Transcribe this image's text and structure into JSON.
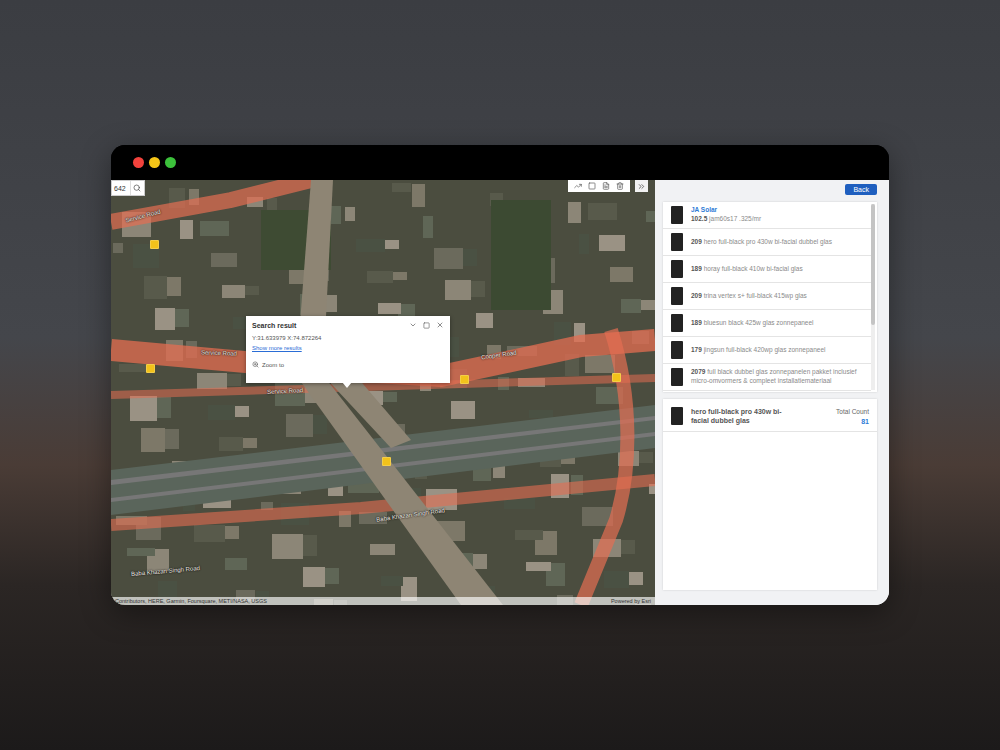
{
  "window": {
    "controls": [
      {
        "color": "#f2423c"
      },
      {
        "color": "#f5c518"
      },
      {
        "color": "#3cc13b"
      }
    ]
  },
  "map": {
    "search": {
      "value": "642"
    },
    "labels": [
      "Service Road",
      "Service Road",
      "Service Road",
      "Cooper Road",
      "Baba Khazan Singh Road",
      "Baba Khazan Singh Road"
    ],
    "popup": {
      "title": "Search result",
      "coords": "Y:31.633979 X:74.872264",
      "link": "Show more results",
      "action": "Zoom to"
    },
    "attribution": "Contributors, HERE, Garmin, Foursquare, METI/NASA, USGS",
    "powered": "Powered by Esri"
  },
  "panel": {
    "back": "Back",
    "scroll_level": 0.65,
    "results": [
      {
        "brand": "JA Solar",
        "number": "102.5",
        "name": "jam60s17 .325/mr"
      },
      {
        "number": "209",
        "name": "hero full-black pro 430w bi-facial dubbel glas"
      },
      {
        "number": "189",
        "name": "horay full-black 410w bi-facial glas"
      },
      {
        "number": "209",
        "name": "trina vertex s+ full-black 415wp glas"
      },
      {
        "number": "189",
        "name": "bluesun black 425w glas zonnepaneel"
      },
      {
        "number": "179",
        "name": "jingsun full-black 420wp glas zonnepaneel"
      },
      {
        "number": "2079",
        "name": "full black dubbel glas zonnepanelen pakket inclusief micro-omvormers & compleet installatiemateriaal"
      }
    ],
    "selected": {
      "name": "hero full-black pro 430w bi-facial dubbel glas",
      "count_label": "Total Count",
      "count": "81"
    }
  }
}
